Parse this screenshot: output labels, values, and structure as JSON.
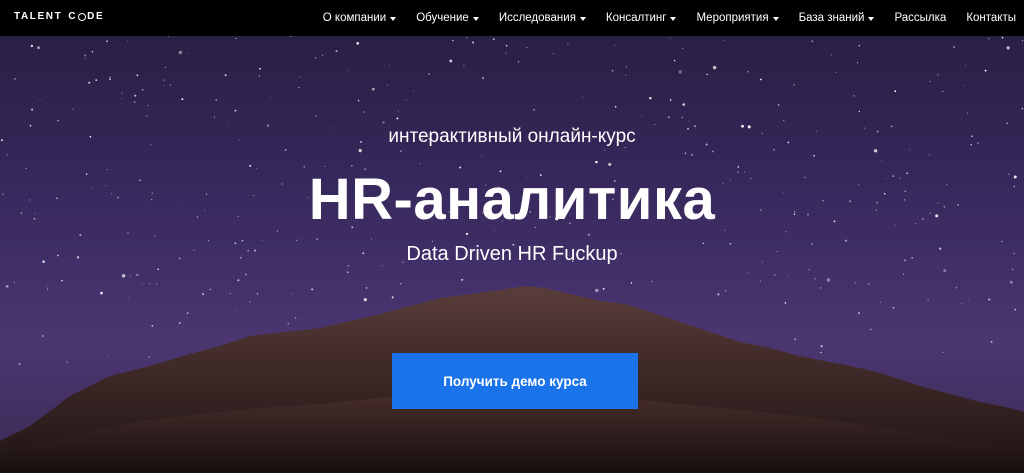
{
  "logo": {
    "part1": "TALENT",
    "part2": "C",
    "part3": "DE"
  },
  "nav": {
    "items": [
      {
        "label": "О компании",
        "dropdown": true
      },
      {
        "label": "Обучение",
        "dropdown": true
      },
      {
        "label": "Исследования",
        "dropdown": true
      },
      {
        "label": "Консалтинг",
        "dropdown": true
      },
      {
        "label": "Мероприятия",
        "dropdown": true
      },
      {
        "label": "База знаний",
        "dropdown": true
      },
      {
        "label": "Рассылка",
        "dropdown": false
      },
      {
        "label": "Контакты",
        "dropdown": false
      }
    ]
  },
  "hero": {
    "subtitle_top": "интерактивный онлайн-курс",
    "title": "HR-аналитика",
    "subtitle_bottom": "Data Driven HR Fuckup",
    "cta_label": "Получить демо курса"
  },
  "colors": {
    "cta": "#1a73e8",
    "navbar": "#000000",
    "sky": "#3a2a5e"
  }
}
